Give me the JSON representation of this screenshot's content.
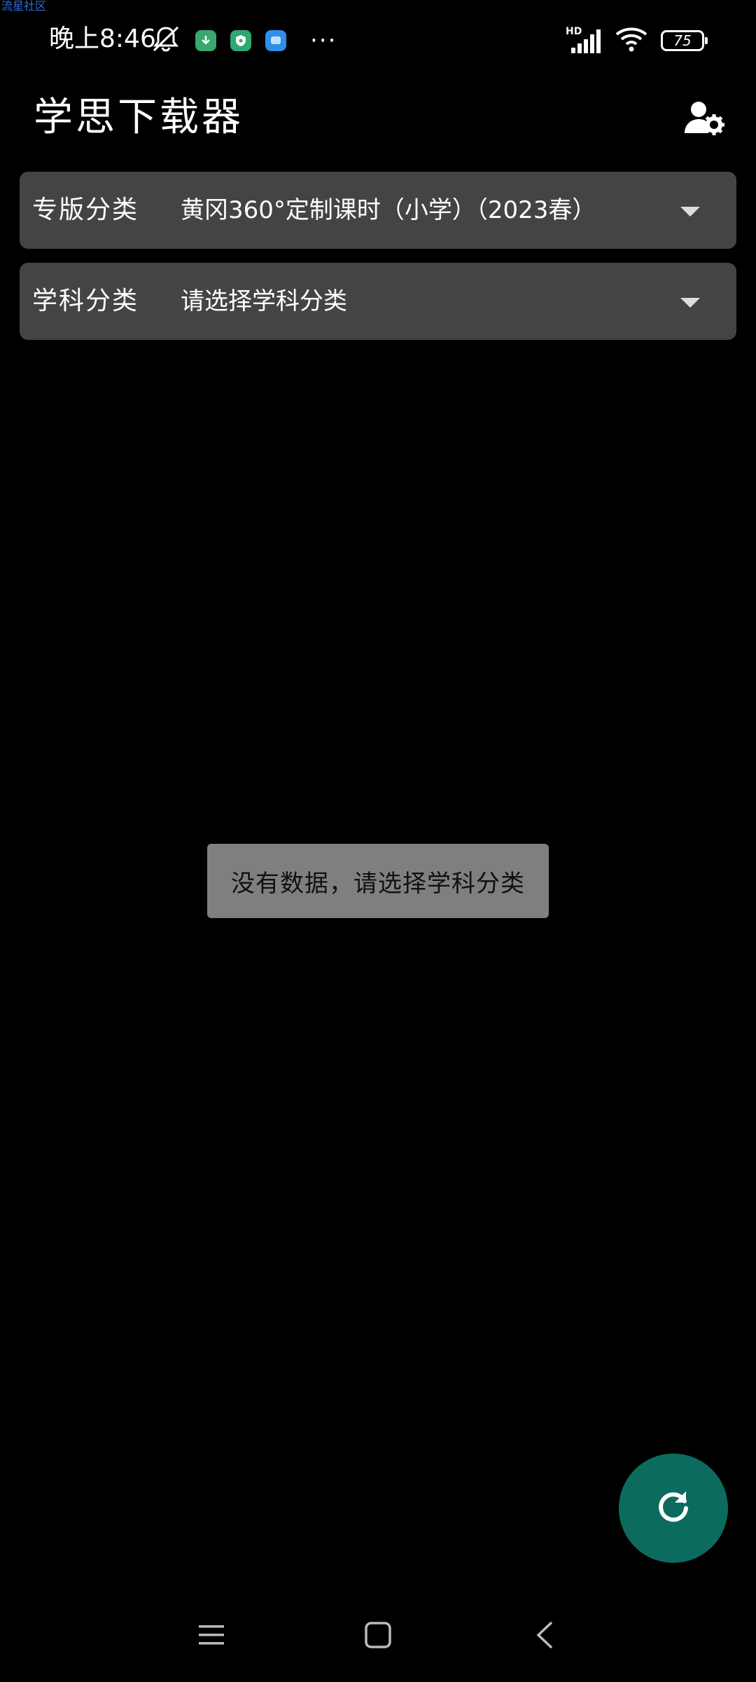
{
  "watermark": "流星社区",
  "status_bar": {
    "time": "晚上8:46",
    "network_label": "HD",
    "battery_level": "75",
    "more_glyph": "···"
  },
  "app_bar": {
    "title": "学思下载器"
  },
  "filters": {
    "edition": {
      "label": "专版分类",
      "value": "黄冈360°定制课时（小学）（2023春）"
    },
    "subject": {
      "label": "学科分类",
      "value": "请选择学科分类"
    }
  },
  "toast": {
    "message": "没有数据，请选择学科分类"
  },
  "colors": {
    "background": "#000000",
    "dropdown_bg": "#444444",
    "toast_bg": "#7f7f7f",
    "fab_bg": "#0c6b5f",
    "watermark": "#2f6fd6"
  }
}
